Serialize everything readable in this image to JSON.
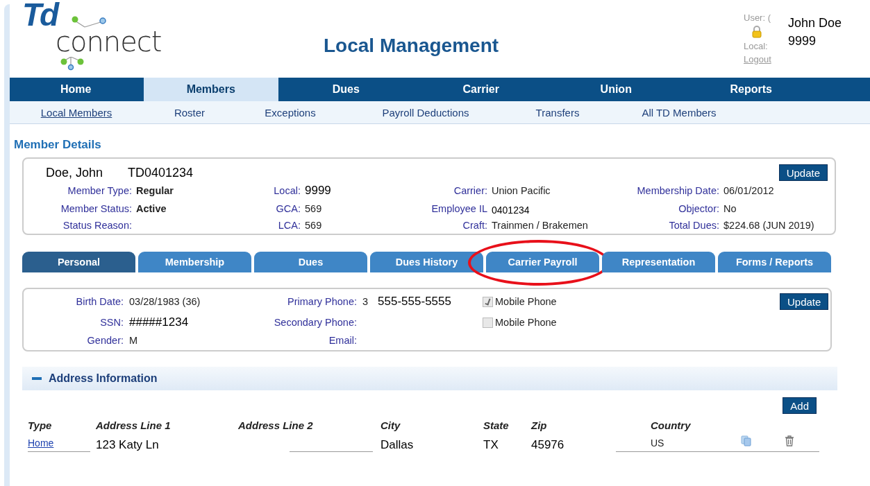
{
  "logo": {
    "part_1": "Td",
    "part_2": "connect"
  },
  "page_title": "Local Management",
  "user_panel": {
    "user_label": "User: (",
    "local_label": "Local:",
    "logout": "Logout",
    "user_name": "John Doe",
    "local_number": "9999"
  },
  "nav": [
    {
      "label": "Home",
      "selected": false
    },
    {
      "label": "Members",
      "selected": true
    },
    {
      "label": "Dues",
      "selected": false
    },
    {
      "label": "Carrier",
      "selected": false
    },
    {
      "label": "Union",
      "selected": false
    },
    {
      "label": "Reports",
      "selected": false
    }
  ],
  "subnav": [
    {
      "label": "Local Members",
      "selected": true
    },
    {
      "label": "Roster",
      "selected": false
    },
    {
      "label": "Exceptions",
      "selected": false
    },
    {
      "label": "Payroll Deductions",
      "selected": false
    },
    {
      "label": "Transfers",
      "selected": false
    },
    {
      "label": "All TD Members",
      "selected": false
    }
  ],
  "member_details": {
    "heading": "Member Details",
    "name": "Doe, John",
    "member_id": "TD0401234",
    "update_button": "Update",
    "rows": [
      [
        {
          "label": "Member Type:",
          "value": "Regular",
          "kind": "bold"
        },
        {
          "label": "Local:",
          "value": "9999",
          "kind": "overlay"
        },
        {
          "label": "Carrier:",
          "value": "Union Pacific",
          "kind": "plain"
        },
        {
          "label": "Membership Date:",
          "value": "06/01/2012",
          "kind": "plain"
        }
      ],
      [
        {
          "label": "Member Status:",
          "value": "Active",
          "kind": "bold"
        },
        {
          "label": "GCA:",
          "value": "569",
          "kind": "plain"
        },
        {
          "label": "Employee IL",
          "value": "0401234",
          "kind": "overlay-small"
        },
        {
          "label": "Objector:",
          "value": "No",
          "kind": "plain"
        }
      ],
      [
        {
          "label": "Status Reason:"
        },
        {
          "label": "LCA:",
          "value": "569",
          "kind": "plain"
        },
        {
          "label": "Craft:",
          "value": "Trainmen / Brakemen",
          "kind": "plain"
        },
        {
          "label": "Total Dues:",
          "value": "$224.68 (JUN 2019)",
          "kind": "plain"
        }
      ]
    ]
  },
  "tabs": [
    {
      "label": "Personal",
      "selected": true,
      "circled": false
    },
    {
      "label": "Membership",
      "selected": false,
      "circled": false
    },
    {
      "label": "Dues",
      "selected": false,
      "circled": false
    },
    {
      "label": "Dues History",
      "selected": false,
      "circled": false
    },
    {
      "label": "Carrier Payroll",
      "selected": false,
      "circled": true
    },
    {
      "label": "Representation",
      "selected": false,
      "circled": false
    },
    {
      "label": "Forms / Reports",
      "selected": false,
      "circled": false
    }
  ],
  "personal": {
    "update_button": "Update",
    "rows": [
      {
        "field_1": {
          "label": "Birth Date:",
          "value": "03/28/1983 (36)",
          "kind": "plain"
        },
        "label_2": "Primary Phone:",
        "value_2": "3",
        "overlay_2": "555-555-5555",
        "checkbox": {
          "label": "Mobile Phone",
          "checked": true
        }
      },
      {
        "field_1": {
          "label": "SSN:",
          "value": "#####1234",
          "kind": "overlay"
        },
        "label_2": "Secondary Phone:",
        "checkbox": {
          "label": "Mobile Phone",
          "checked": false
        }
      },
      {
        "field_1": {
          "label": "Gender:",
          "value": "M",
          "kind": "plain"
        },
        "label_2": "Email:"
      }
    ]
  },
  "address": {
    "heading": "Address Information",
    "expanded": true,
    "add_button": "Add",
    "columns": [
      "Type",
      "Address Line 1",
      "Address Line 2",
      "City",
      "State",
      "Zip",
      "Country"
    ],
    "rows": [
      {
        "type": "Home",
        "line_1": "123 Katy Ln",
        "city": "Dallas",
        "state": "TX",
        "zip": "45976",
        "country": "US"
      }
    ]
  }
}
